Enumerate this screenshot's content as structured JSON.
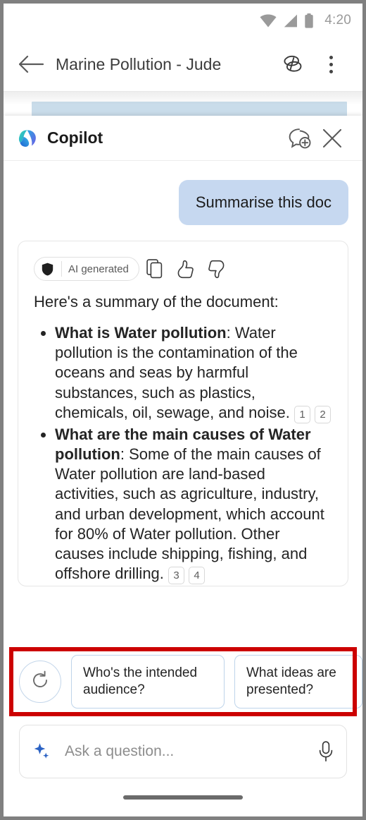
{
  "status_bar": {
    "time": "4:20",
    "icons": [
      "wifi-icon",
      "signal-icon",
      "battery-icon"
    ]
  },
  "app_bar": {
    "back_label": "back-arrow",
    "document_title": "Marine Pollution - Jude",
    "copilot_icon": "copilot-doc-icon",
    "overflow_icon": "more-options-icon"
  },
  "panel": {
    "title": "Copilot",
    "logo": "copilot-logo",
    "new_chat_icon": "new-chat-icon",
    "close_icon": "close-icon"
  },
  "conversation": {
    "user_message": "Summarise this doc",
    "response": {
      "badge": {
        "icon": "shield-icon",
        "label": "AI generated"
      },
      "actions": [
        {
          "name": "copy-icon",
          "label": "Copy"
        },
        {
          "name": "thumbs-up-icon",
          "label": "Like"
        },
        {
          "name": "thumbs-down-icon",
          "label": "Dislike"
        }
      ],
      "intro": "Here's a summary of the document:",
      "bullets": [
        {
          "heading": "What is Water pollution",
          "body": ": Water pollution is the contamination of the oceans and seas by harmful substances, such as plastics, chemicals, oil, sewage, and noise.",
          "citations": [
            "1",
            "2"
          ]
        },
        {
          "heading": "What are the main causes of Water pollution",
          "body": ": Some of the main causes of Water pollution are land-based activities, such as agriculture, industry, and urban development, which account for 80% of Water pollution. Other causes include shipping, fishing, and offshore drilling.",
          "citations": [
            "3",
            "4"
          ]
        }
      ]
    }
  },
  "suggestions": {
    "refresh_icon": "refresh-icon",
    "chips": [
      "Who's the intended\naudience?",
      "What ideas are\npresented?",
      ""
    ]
  },
  "composer": {
    "sparkle_icon": "copilot-sparkle-icon",
    "placeholder": "Ask a question...",
    "value": "",
    "mic_icon": "microphone-icon"
  },
  "colors": {
    "accent_blue": "#2b6cb8",
    "user_bubble": "#c6d8f0",
    "chip_border": "#bed4ea",
    "highlight_box": "#cc0000",
    "doc_highlight": "#c9dcea"
  }
}
